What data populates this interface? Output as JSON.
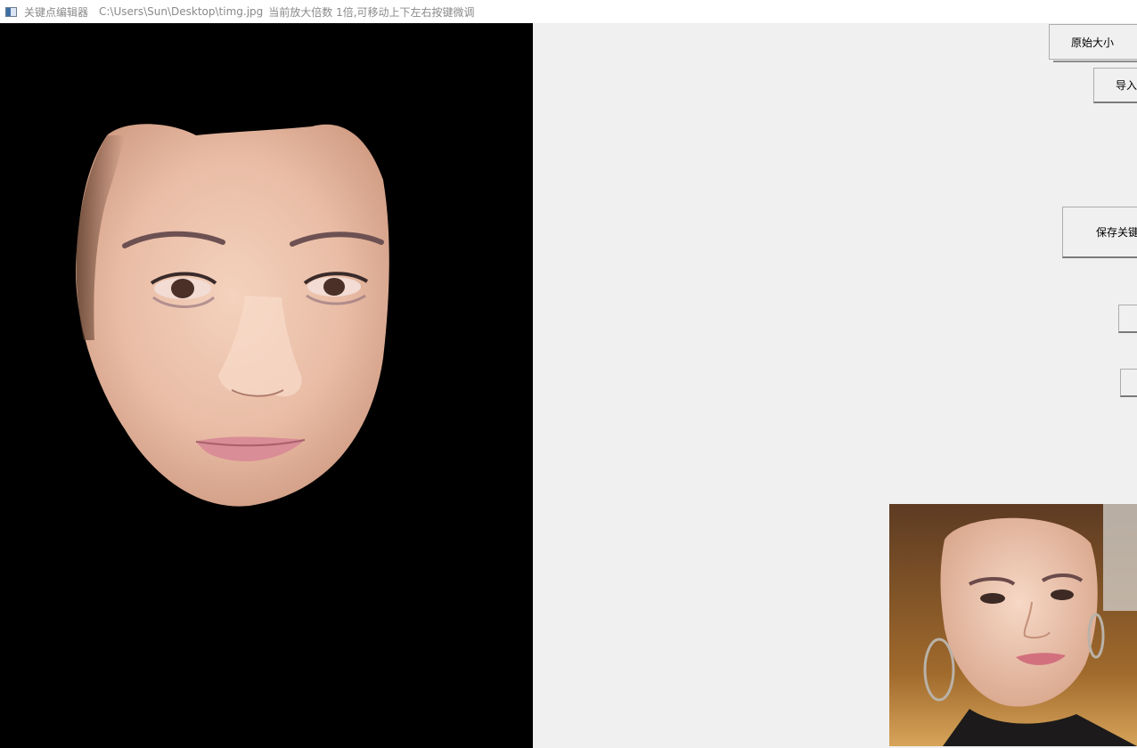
{
  "window": {
    "title": "关键点编辑器",
    "path": "C:\\Users\\Sun\\Desktop\\timg.jpg",
    "status": "当前放大倍数 1倍,可移动上下左右按键微调",
    "icon": "app-window-icon"
  },
  "canvas": {
    "background_color": "#000000",
    "content": "face-mask-image"
  },
  "buttons": {
    "original_size": "原始大小",
    "import": "导入",
    "save_keypoints": "保存关键",
    "unlabeled_1": "",
    "unlabeled_2": ""
  },
  "preview": {
    "content": "source-face-photo"
  },
  "colors": {
    "titlebar_bg": "#ffffff",
    "panel_bg": "#f0f0f0",
    "canvas_bg": "#000000"
  }
}
